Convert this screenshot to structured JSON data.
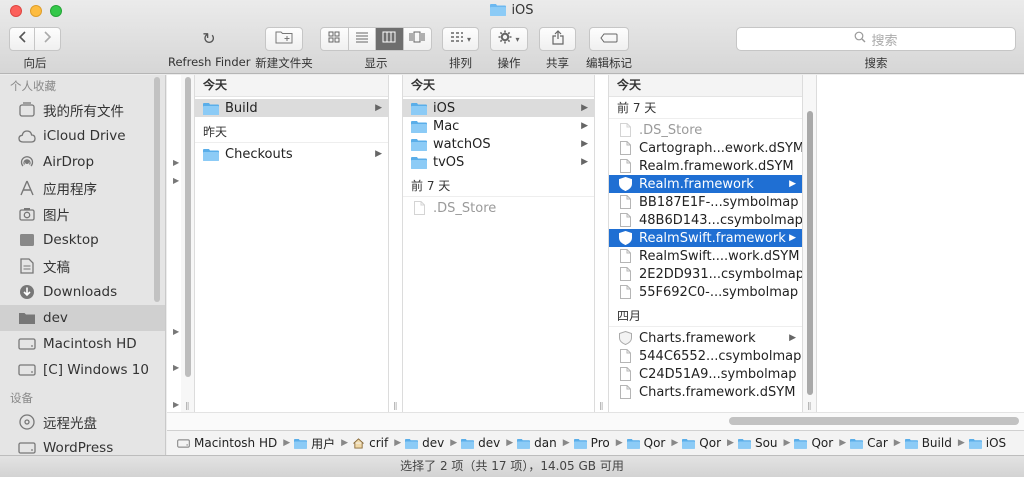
{
  "window": {
    "title": "iOS"
  },
  "toolbar": {
    "back_label": "向后",
    "refresh_icon": "↻",
    "refresh_label": "Refresh Finder",
    "new_folder_label": "新建文件夹",
    "view_label": "显示",
    "arrange_label": "排列",
    "action_label": "操作",
    "share_label": "共享",
    "tags_label": "编辑标记",
    "search_label": "搜索",
    "search_placeholder": "搜索"
  },
  "sidebar": {
    "favorites_header": "个人收藏",
    "favorites": [
      {
        "label": "我的所有文件",
        "icon": "all-files-icon"
      },
      {
        "label": "iCloud Drive",
        "icon": "cloud-icon"
      },
      {
        "label": "AirDrop",
        "icon": "airdrop-icon"
      },
      {
        "label": "应用程序",
        "icon": "applications-icon"
      },
      {
        "label": "图片",
        "icon": "camera-icon"
      },
      {
        "label": "Desktop",
        "icon": "desktop-icon"
      },
      {
        "label": "文稿",
        "icon": "documents-icon"
      },
      {
        "label": "Downloads",
        "icon": "download-icon"
      },
      {
        "label": "dev",
        "icon": "folder-icon",
        "selected": true
      },
      {
        "label": "Macintosh HD",
        "icon": "disk-icon"
      },
      {
        "label": "[C] Windows 10",
        "icon": "disk-icon"
      }
    ],
    "devices_header": "设备",
    "devices": [
      {
        "label": "远程光盘",
        "icon": "optical-disc-icon"
      },
      {
        "label": "WordPress",
        "icon": "disk-icon"
      }
    ]
  },
  "columns": {
    "col1": {
      "sections": [
        {
          "header": "今天",
          "items": [
            {
              "name": "Build",
              "type": "folder",
              "selected": "grey",
              "arrow": true
            }
          ]
        },
        {
          "header": "昨天",
          "items": [
            {
              "name": "Checkouts",
              "type": "folder",
              "arrow": true
            }
          ]
        }
      ]
    },
    "col2": {
      "sections": [
        {
          "header": "今天",
          "items": [
            {
              "name": "iOS",
              "type": "folder",
              "selected": "grey",
              "arrow": true
            },
            {
              "name": "Mac",
              "type": "folder",
              "arrow": true
            },
            {
              "name": "watchOS",
              "type": "folder",
              "arrow": true
            },
            {
              "name": "tvOS",
              "type": "folder",
              "arrow": true
            }
          ]
        },
        {
          "header": "前 7 天",
          "items": [
            {
              "name": ".DS_Store",
              "type": "file",
              "dim": true
            }
          ]
        }
      ]
    },
    "col3": {
      "header": "今天",
      "sections": [
        {
          "header": "前 7 天",
          "items": [
            {
              "name": ".DS_Store",
              "type": "file",
              "dim": true
            },
            {
              "name": "Cartograph...ework.dSYM",
              "type": "file"
            },
            {
              "name": "Realm.framework.dSYM",
              "type": "file"
            },
            {
              "name": "Realm.framework",
              "type": "framework",
              "selected": "blue",
              "arrow": true
            },
            {
              "name": "BB187E1F-...symbolmap",
              "type": "file"
            },
            {
              "name": "48B6D143...csymbolmap",
              "type": "file"
            },
            {
              "name": "RealmSwift.framework",
              "type": "framework",
              "selected": "blue",
              "arrow": true
            },
            {
              "name": "RealmSwift....work.dSYM",
              "type": "file"
            },
            {
              "name": "2E2DD931...csymbolmap",
              "type": "file"
            },
            {
              "name": "55F692C0-...symbolmap",
              "type": "file"
            }
          ]
        },
        {
          "header": "四月",
          "items": [
            {
              "name": "Charts.framework",
              "type": "framework",
              "arrow": true
            },
            {
              "name": "544C6552...csymbolmap",
              "type": "file"
            },
            {
              "name": "C24D51A9...symbolmap",
              "type": "file"
            },
            {
              "name": "Charts.framework.dSYM",
              "type": "file"
            }
          ]
        }
      ]
    }
  },
  "pathbar": [
    {
      "label": "Macintosh HD",
      "icon": "disk-icon"
    },
    {
      "label": "用户",
      "icon": "folder-icon"
    },
    {
      "label": "crif",
      "icon": "home-icon"
    },
    {
      "label": "dev",
      "icon": "folder-icon"
    },
    {
      "label": "dev",
      "icon": "folder-icon"
    },
    {
      "label": "dan",
      "icon": "folder-icon"
    },
    {
      "label": "Pro",
      "icon": "folder-icon"
    },
    {
      "label": "Qor",
      "icon": "folder-icon"
    },
    {
      "label": "Qor",
      "icon": "folder-icon"
    },
    {
      "label": "Sou",
      "icon": "folder-icon"
    },
    {
      "label": "Qor",
      "icon": "folder-icon"
    },
    {
      "label": "Car",
      "icon": "folder-icon"
    },
    {
      "label": "Build",
      "icon": "folder-icon"
    },
    {
      "label": "iOS",
      "icon": "folder-icon"
    }
  ],
  "status": {
    "text": "选择了 2 项（共 17 项），14.05 GB 可用"
  },
  "colors": {
    "selection_blue": "#1f6fd3",
    "folder_blue": "#6cb8f0",
    "accent_grey": "#6e6e6e"
  }
}
